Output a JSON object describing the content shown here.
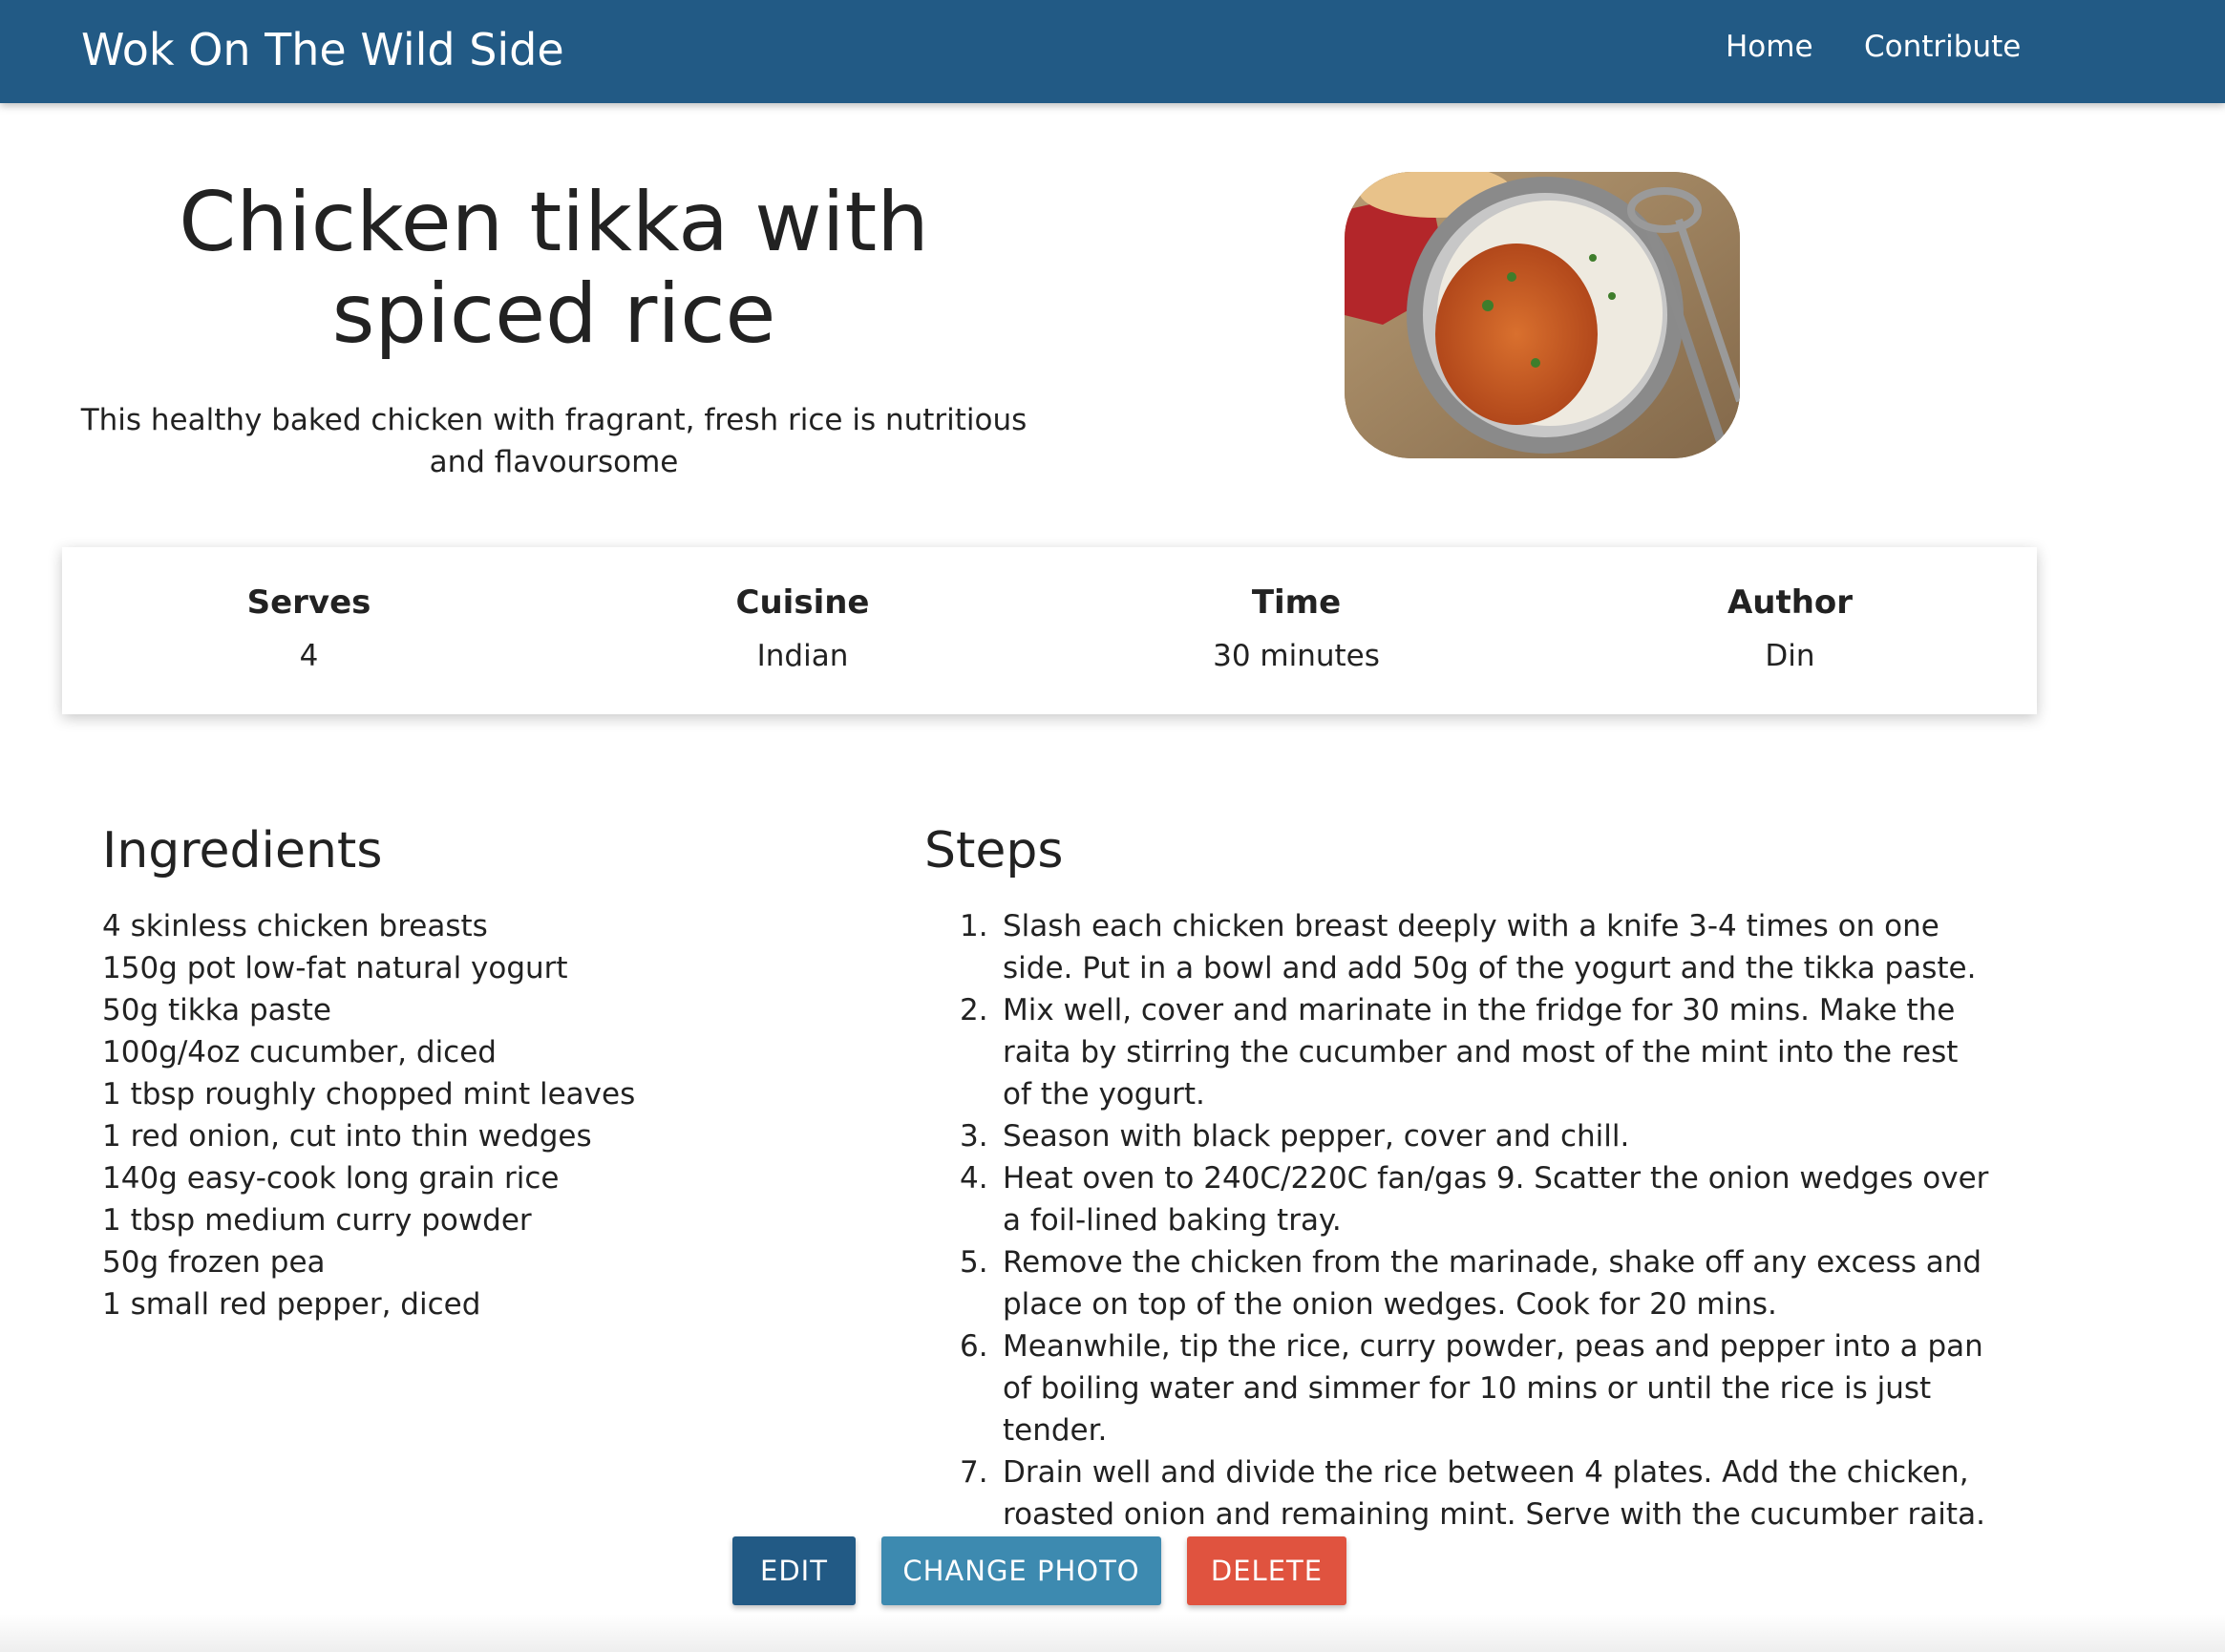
{
  "navbar": {
    "brand": "Wok On The Wild Side",
    "links": [
      "Home",
      "Contribute"
    ],
    "color": "#225a85"
  },
  "recipe": {
    "title": "Chicken tikka with spiced rice",
    "description": "This healthy baked chicken with fragrant, fresh rice is nutritious and flavoursome",
    "photo_icon": "recipe-photo"
  },
  "info": [
    {
      "label": "Serves",
      "value": "4"
    },
    {
      "label": "Cuisine",
      "value": "Indian"
    },
    {
      "label": "Time",
      "value": "30 minutes"
    },
    {
      "label": "Author",
      "value": "Din"
    }
  ],
  "ingredients_title": "Ingredients",
  "ingredients": [
    "4 skinless chicken breasts",
    "150g pot low-fat natural yogurt",
    "50g tikka paste",
    "100g/4oz cucumber, diced",
    "1 tbsp roughly chopped mint leaves",
    "1 red onion, cut into thin wedges",
    "140g easy-cook long grain rice",
    "1 tbsp medium curry powder",
    "50g frozen pea",
    "1 small red pepper, diced"
  ],
  "steps_title": "Steps",
  "steps": [
    {
      "num": "1.",
      "text": "Slash each chicken breast deeply with a knife 3-4 times on one side. Put in a bowl and add 50g of the yogurt and the tikka paste."
    },
    {
      "num": "2.",
      "text": "Mix well, cover and marinate in the fridge for 30 mins. Make the raita by stirring the cucumber and most of the mint into the rest of the yogurt."
    },
    {
      "num": "3.",
      "text": "Season with black pepper, cover and chill."
    },
    {
      "num": "4.",
      "text": "Heat oven to 240C/220C fan/gas 9. Scatter the onion wedges over a foil-lined baking tray."
    },
    {
      "num": "5.",
      "text": "Remove the chicken from the marinade, shake off any excess and place on top of the onion wedges. Cook for 20 mins."
    },
    {
      "num": "6.",
      "text": "Meanwhile, tip the rice, curry powder, peas and pepper into a pan of boiling water and simmer for 10 mins or until the rice is just tender."
    },
    {
      "num": "7.",
      "text": "Drain well and divide the rice between 4 plates. Add the chicken, roasted onion and remaining mint. Serve with the cucumber raita."
    }
  ],
  "buttons": {
    "edit": "EDIT",
    "change_photo": "CHANGE PHOTO",
    "delete": "DELETE"
  },
  "colors": {
    "edit": "#225a85",
    "change_photo": "#3d8ab0",
    "delete": "#e0533f"
  }
}
